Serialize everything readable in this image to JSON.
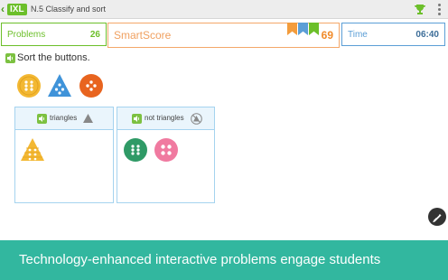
{
  "topbar": {
    "back_glyph": "‹",
    "logo_text": "IXL",
    "breadcrumb": "N.5 Classify and sort",
    "trophy_icon": "trophy-icon",
    "menu_icon": "overflow-menu-icon"
  },
  "stats": {
    "problems_label": "Problems",
    "problems_value": "26",
    "smartscore_label": "SmartScore",
    "smartscore_value": "69",
    "time_label": "Time",
    "time_value": "06:40"
  },
  "ribbon_colors": [
    "#f39c3c",
    "#5b9ed6",
    "#6cbf2a"
  ],
  "question": {
    "instruction": "Sort the buttons.",
    "speaker_icon": "speaker-icon"
  },
  "unsorted_buttons": [
    {
      "shape": "circle",
      "color": "#f3b833",
      "holes": 6
    },
    {
      "shape": "triangle",
      "color": "#3f93d9",
      "holes": 4
    },
    {
      "shape": "circle",
      "color": "#e8641f",
      "holes": 4
    }
  ],
  "bins": [
    {
      "label": "triangles",
      "icon": "triangle-icon",
      "items": [
        {
          "shape": "triangle",
          "color": "#f3b833",
          "holes": 6
        }
      ]
    },
    {
      "label": "not triangles",
      "icon": "not-triangle-icon",
      "items": [
        {
          "shape": "circle",
          "color": "#2f9a66",
          "holes": 6
        },
        {
          "shape": "circle",
          "color": "#f07aa0",
          "holes": 4
        }
      ]
    }
  ],
  "scratchpad_icon": "pencil-icon",
  "banner": {
    "text": "Technology-enhanced interactive problems engage students"
  }
}
